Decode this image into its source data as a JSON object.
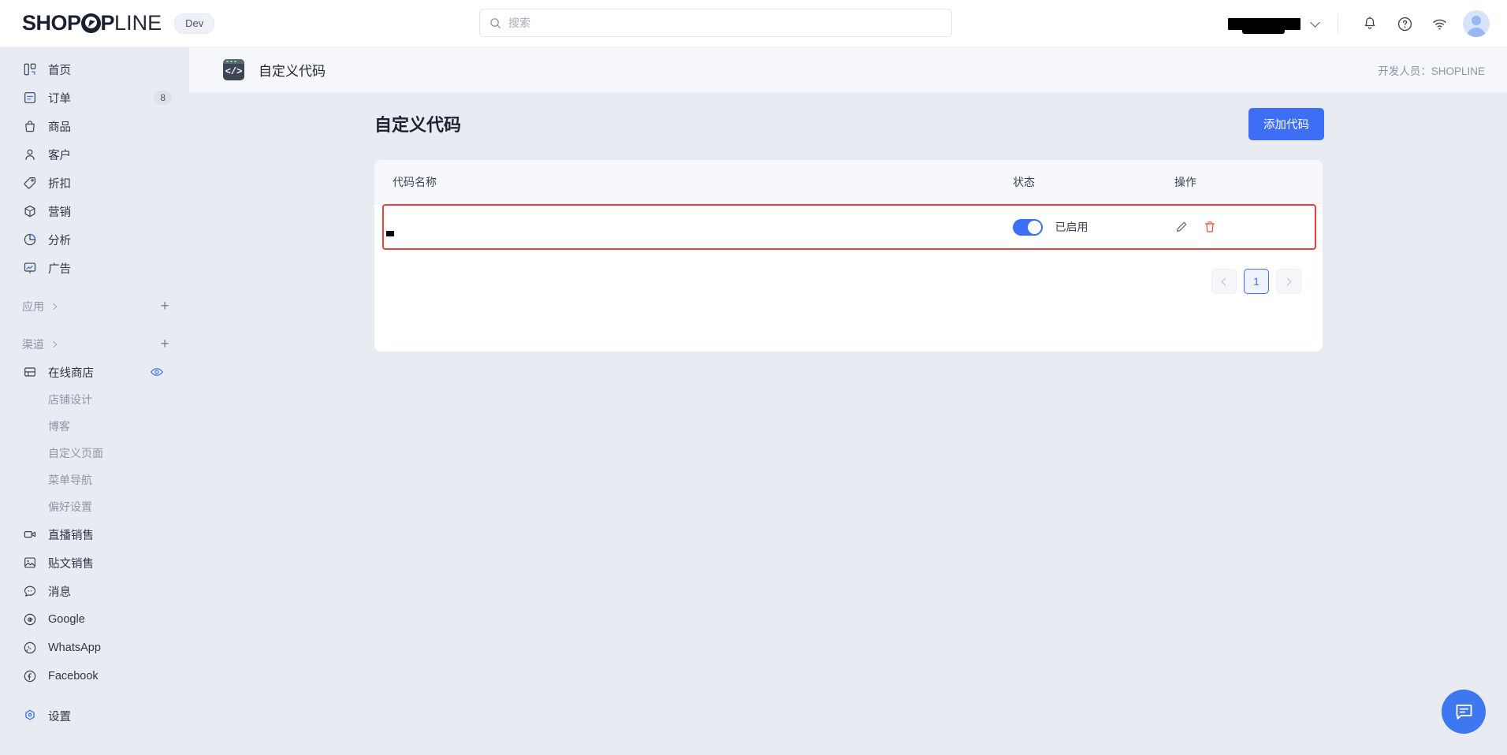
{
  "topbar": {
    "brand_bold": "SHOP",
    "brand_light": "LINE",
    "dev_badge": "Dev",
    "search_placeholder": "搜索",
    "search_value": "",
    "store_name": "",
    "icons": {
      "search": "search-icon",
      "bell": "bell-icon",
      "help": "help-circle-icon",
      "wifi": "wifi-icon",
      "avatar": "avatar-icon",
      "chevron": "chevron-down-icon"
    }
  },
  "sidebar": {
    "items": [
      {
        "label": "首页",
        "icon": "dashboard-icon",
        "badge": ""
      },
      {
        "label": "订单",
        "icon": "orders-icon",
        "badge": "8"
      },
      {
        "label": "商品",
        "icon": "products-icon",
        "badge": ""
      },
      {
        "label": "客户",
        "icon": "customers-icon",
        "badge": ""
      },
      {
        "label": "折扣",
        "icon": "discount-tag-icon",
        "badge": ""
      },
      {
        "label": "营销",
        "icon": "marketing-box-icon",
        "badge": ""
      },
      {
        "label": "分析",
        "icon": "analytics-pie-icon",
        "badge": ""
      },
      {
        "label": "广告",
        "icon": "ads-icon",
        "badge": ""
      }
    ],
    "section_apps": {
      "label": "应用",
      "add": "+"
    },
    "section_channels": {
      "label": "渠道",
      "add": "+"
    },
    "online_store": {
      "label": "在线商店",
      "icon": "store-icon"
    },
    "sub_items": [
      {
        "label": "店铺设计"
      },
      {
        "label": "博客"
      },
      {
        "label": "自定义页面"
      },
      {
        "label": "菜单导航"
      },
      {
        "label": "偏好设置"
      }
    ],
    "bottom_items": [
      {
        "label": "直播销售",
        "icon": "live-video-icon"
      },
      {
        "label": "贴文销售",
        "icon": "post-image-icon"
      },
      {
        "label": "消息",
        "icon": "message-icon"
      },
      {
        "label": "Google",
        "icon": "google-icon"
      },
      {
        "label": "WhatsApp",
        "icon": "whatsapp-icon"
      },
      {
        "label": "Facebook",
        "icon": "facebook-icon"
      }
    ],
    "settings": {
      "label": "设置",
      "icon": "settings-gear-icon"
    }
  },
  "page_header": {
    "app_icon": "code-brackets-icon",
    "app_icon_text": "</>",
    "title": "自定义代码",
    "developer": "开发人员：SHOPLINE"
  },
  "main": {
    "title": "自定义代码",
    "add_button": "添加代码",
    "table": {
      "columns": [
        "代码名称",
        "状态",
        "操作"
      ],
      "rows": [
        {
          "name": "",
          "status_enabled": true,
          "status_label": "已启用",
          "actions": [
            "edit-pencil-icon",
            "delete-trash-icon"
          ]
        }
      ]
    },
    "pagination": {
      "prev": "chevron-left-icon",
      "next": "chevron-right-icon",
      "current_page": "1"
    }
  },
  "chat": {
    "icon": "chat-bubble-icon"
  },
  "colors": {
    "accent": "#3d6ef5",
    "sidebar_bg": "#e8ecf2",
    "highlight_border": "#e8413a",
    "page_bg": "#e8ecf2",
    "card_bg": "#ffffff",
    "delete_icon": "#e8523f"
  }
}
